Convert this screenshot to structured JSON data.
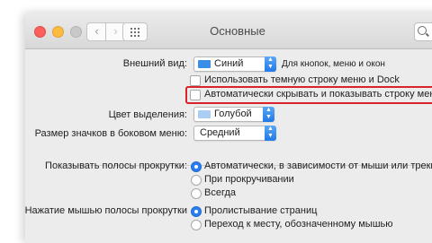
{
  "window": {
    "title": "Основные",
    "back_glyph": "‹",
    "forward_glyph": "›"
  },
  "appearance": {
    "label": "Внешний вид:",
    "value": "Синий",
    "hint": "Для кнопок, меню и окон",
    "swatch_color": "#3a8ee6"
  },
  "dark_menu": {
    "label": "Использовать темную строку меню и Dock"
  },
  "autohide": {
    "label": "Автоматически скрывать и показывать строку меню",
    "highlight_color": "#d9222a"
  },
  "highlight_color": {
    "label": "Цвет выделения:",
    "value": "Голубой",
    "swatch_color": "#a9cdf3"
  },
  "sidebar_size": {
    "label": "Размер значков в боковом меню:",
    "value": "Средний"
  },
  "scrollbars": {
    "label": "Показывать полосы прокрутки:",
    "options": [
      {
        "label": "Автоматически, в зависимости от мыши или трекпада",
        "selected": true
      },
      {
        "label": "При прокручивании",
        "selected": false
      },
      {
        "label": "Всегда",
        "selected": false
      }
    ]
  },
  "click_scroll": {
    "label": "Нажатие мышью полосы прокрутки",
    "options": [
      {
        "label": "Пролистывание страниц",
        "selected": true
      },
      {
        "label": "Переход к месту, обозначенному мышью",
        "selected": false
      }
    ]
  }
}
